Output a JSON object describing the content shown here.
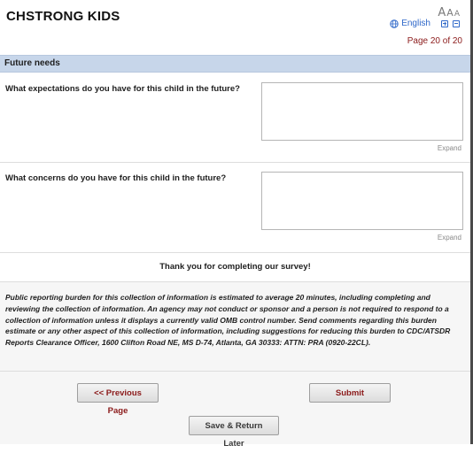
{
  "header": {
    "title": "CHSTRONG KIDS",
    "font_size_controls": [
      "A",
      "A",
      "A"
    ],
    "language": "English",
    "globe_icon": "globe-icon",
    "page_indicator": "Page 20 of 20"
  },
  "section": {
    "title": "Future needs"
  },
  "questions": [
    {
      "label": "What expectations do you have for this child in the future?",
      "value": "",
      "expand_label": "Expand"
    },
    {
      "label": "What concerns do you have for this child in the future?",
      "value": "",
      "expand_label": "Expand"
    }
  ],
  "thanks": "Thank you for completing our survey!",
  "burden_statement": "Public reporting burden for this collection of information is estimated to average 20 minutes, including completing and reviewing the collection of information. An agency may not conduct or sponsor and a person is not required to respond to a collection of information unless it displays a currently valid OMB control number. Send comments regarding this burden estimate or any other aspect of this collection of information, including suggestions for reducing this burden to CDC/ATSDR Reports Clearance Officer, 1600 Clifton Road NE, MS D-74, Atlanta, GA 30333: ATTN: PRA (0920-22CL).",
  "buttons": {
    "previous": "<< Previous Page",
    "submit": "Submit",
    "save_return": "Save & Return Later"
  },
  "colors": {
    "section_bar": "#c7d6ea",
    "link_blue": "#2f68c9",
    "accent_red": "#8b1a1a"
  }
}
